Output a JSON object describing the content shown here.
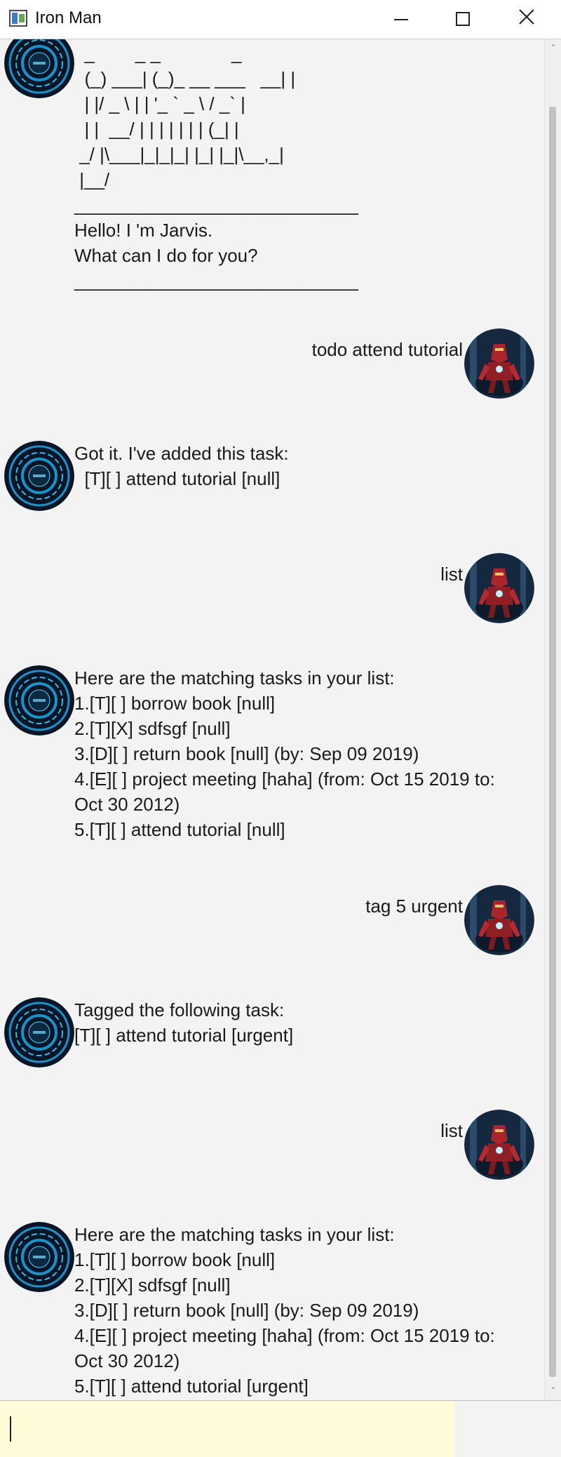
{
  "window": {
    "title": "Iron Man",
    "minimize_icon": "minimize-icon",
    "maximize_icon": "maximize-icon",
    "close_icon": "close-icon"
  },
  "colors": {
    "input_background": "#fffbd9",
    "chat_background": "#f3f3f3",
    "jarvis_ring": "#1e90c8"
  },
  "avatars": {
    "bot": "jarvis-avatar",
    "user": "ironman-avatar"
  },
  "messages": [
    {
      "sender": "bot",
      "lines": [
        "  _        _ _              _",
        "  (_) ___| (_)_ __ ___   __| |",
        "  | |/ _ \\ | | '_ ` _ \\ / _` |",
        "  | |  __/ | | | | | | | (_| |",
        " _/ |\\___|_|_|_| |_| |_|\\__,_|",
        " |__/",
        "____________________________",
        "Hello! I 'm Jarvis.",
        "What can I do for you?",
        "____________________________"
      ]
    },
    {
      "sender": "user",
      "text": "todo attend tutorial"
    },
    {
      "sender": "bot",
      "lines": [
        "Got it. I've added this task:",
        "  [T][ ] attend tutorial [null]"
      ]
    },
    {
      "sender": "user",
      "text": "list"
    },
    {
      "sender": "bot",
      "lines": [
        "Here are the matching tasks in your list:",
        "1.[T][ ] borrow book [null]",
        "2.[T][X] sdfsgf [null]",
        "3.[D][ ] return book [null] (by: Sep 09 2019)",
        "4.[E][ ] project meeting [haha] (from: Oct 15 2019 to:",
        "Oct 30 2012)",
        "5.[T][ ] attend tutorial [null]"
      ]
    },
    {
      "sender": "user",
      "text": "tag 5 urgent"
    },
    {
      "sender": "bot",
      "lines": [
        "Tagged the following task:",
        "[T][ ] attend tutorial [urgent]"
      ]
    },
    {
      "sender": "user",
      "text": "list"
    },
    {
      "sender": "bot",
      "lines": [
        "Here are the matching tasks in your list:",
        "1.[T][ ] borrow book [null]",
        "2.[T][X] sdfsgf [null]",
        "3.[D][ ] return book [null] (by: Sep 09 2019)",
        "4.[E][ ] project meeting [haha] (from: Oct 15 2019 to:",
        "Oct 30 2012)",
        "5.[T][ ] attend tutorial [urgent]"
      ]
    }
  ],
  "input": {
    "value": "",
    "placeholder": ""
  }
}
